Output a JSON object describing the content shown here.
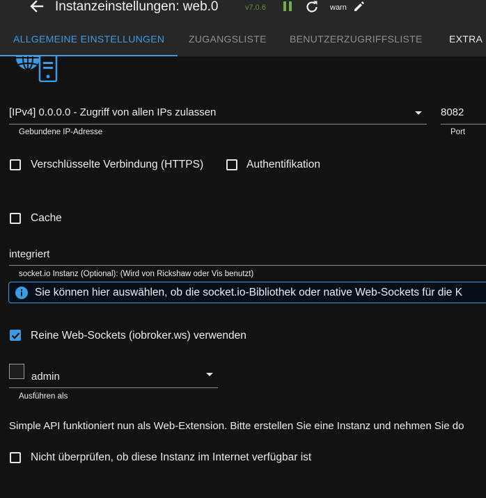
{
  "header": {
    "title": "Instanzeinstellungen: web.0",
    "version": "v7.0.6",
    "log_level": "warn",
    "icons": [
      "back-arrow-icon",
      "pause-icon",
      "reload-icon",
      "edit-icon"
    ]
  },
  "tabs": [
    {
      "label": "ALLGEMEINE EINSTELLUNGEN",
      "active": true
    },
    {
      "label": "ZUGANGSLISTE",
      "active": false
    },
    {
      "label": "BENUTZERZUGRIFFSLISTE",
      "active": false
    },
    {
      "label": "EXTRA",
      "active": false
    }
  ],
  "form": {
    "bind": {
      "value": "[IPv4] 0.0.0.0 - Zugriff von allen IPs zulassen",
      "helper": "Gebundene IP-Adresse"
    },
    "port": {
      "value": "8082",
      "helper": "Port"
    },
    "https": {
      "label": "Verschlüsselte Verbindung (HTTPS)",
      "checked": false
    },
    "auth": {
      "label": "Authentifikation",
      "checked": false
    },
    "cache": {
      "label": "Cache",
      "checked": false
    },
    "socketio": {
      "value": "integriert",
      "helper": "socket.io Instanz (Optional): (Wird von Rickshaw oder Vis benutzt)"
    },
    "info": {
      "text": "Sie können hier auswählen, ob die socket.io-Bibliothek oder native Web-Sockets für die K"
    },
    "pure_ws": {
      "label": "Reine Web-Sockets (iobroker.ws) verwenden",
      "checked": true
    },
    "run_as": {
      "value": "admin",
      "helper": "Ausführen als"
    },
    "simple_api_notice": "Simple API funktioniert nun als Web-Extension. Bitte erstellen Sie eine Instanz und nehmen Sie do",
    "no_check": {
      "label": "Nicht überprüfen, ob diese Instanz im Internet verfügbar ist",
      "checked": false
    }
  },
  "colors": {
    "accent": "#3d9be3",
    "running": "#5b8f3c",
    "background": "#121212",
    "toolbar": "#272727"
  }
}
